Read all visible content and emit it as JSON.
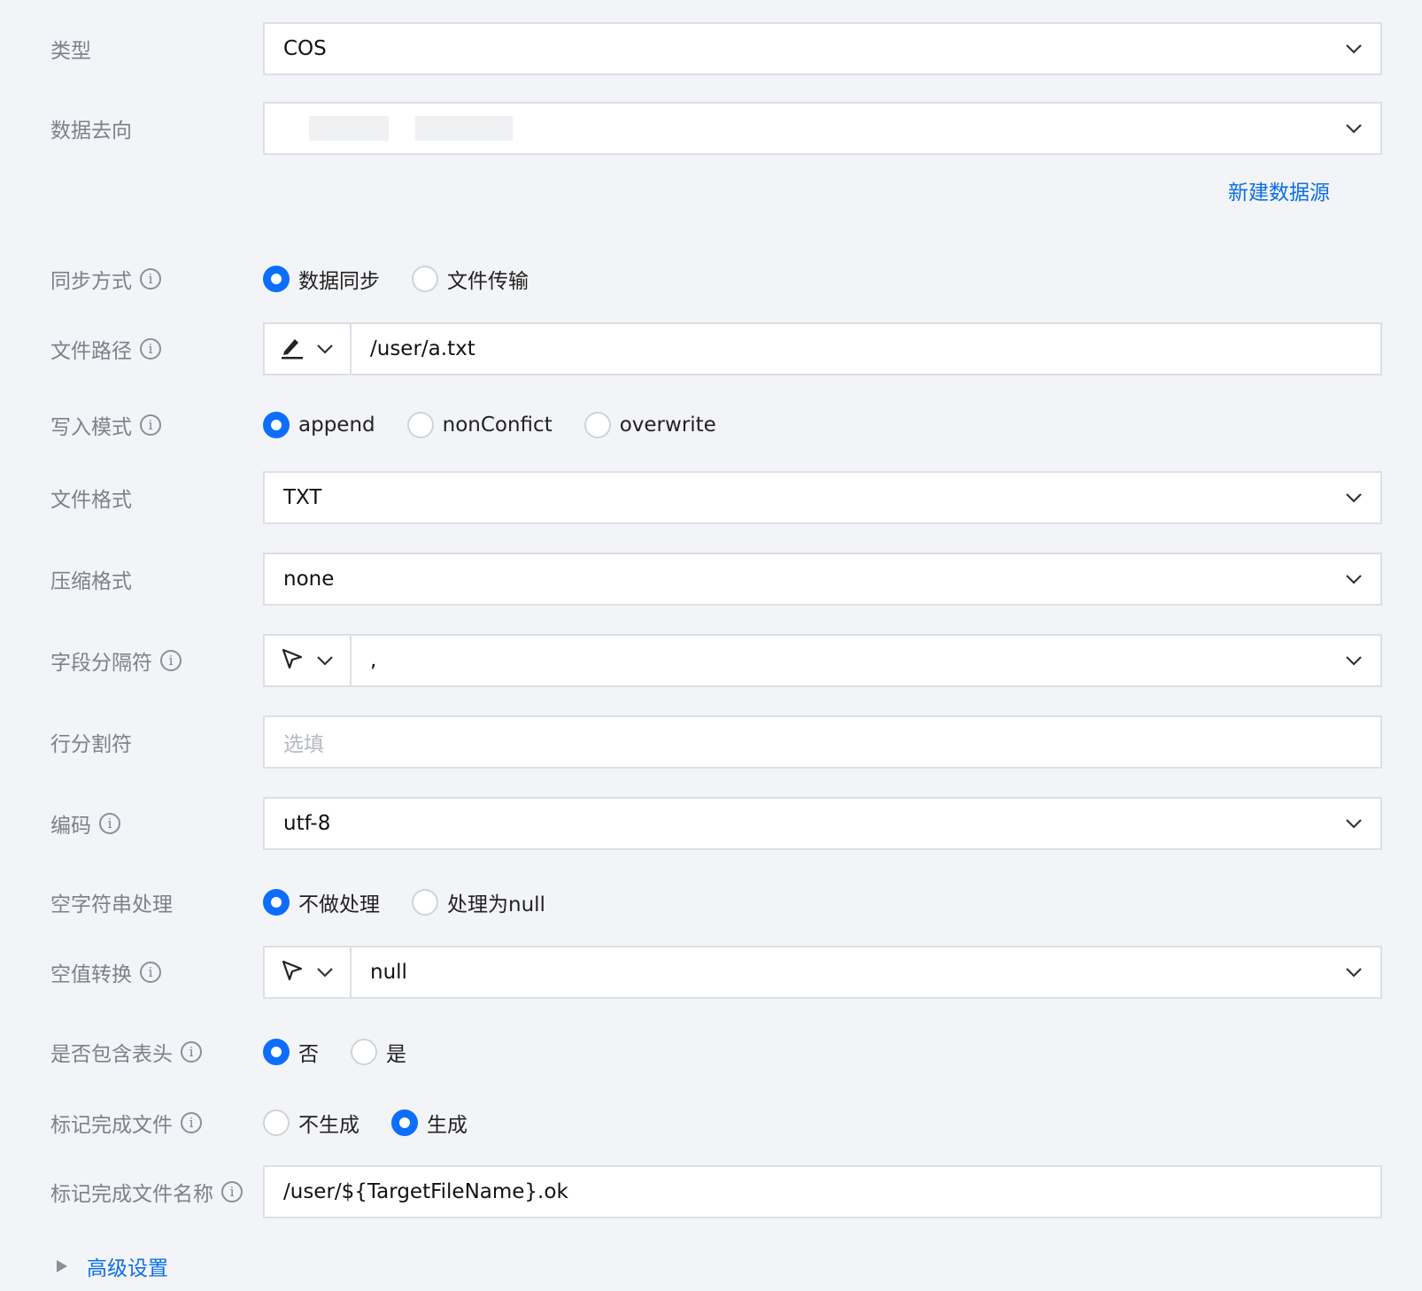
{
  "type": {
    "label": "类型",
    "value": "COS"
  },
  "destination": {
    "label": "数据去向",
    "value": "",
    "new_source_link": "新建数据源"
  },
  "sync_mode": {
    "label": "同步方式",
    "options": [
      "数据同步",
      "文件传输"
    ],
    "selected": 0
  },
  "file_path": {
    "label": "文件路径",
    "prefix_icon": "edit-pen-icon",
    "value": "/user/a.txt"
  },
  "write_mode": {
    "label": "写入模式",
    "options": [
      "append",
      "nonConfict",
      "overwrite"
    ],
    "selected": 0
  },
  "file_format": {
    "label": "文件格式",
    "value": "TXT"
  },
  "compression": {
    "label": "压缩格式",
    "value": "none"
  },
  "field_delimiter": {
    "label": "字段分隔符",
    "prefix_icon": "cursor-pointer-icon",
    "value": ","
  },
  "row_delimiter": {
    "label": "行分割符",
    "placeholder": "选填"
  },
  "encoding": {
    "label": "编码",
    "value": "utf-8"
  },
  "empty_string": {
    "label": "空字符串处理",
    "options": [
      "不做处理",
      "处理为null"
    ],
    "selected": 0
  },
  "null_conversion": {
    "label": "空值转换",
    "prefix_icon": "cursor-pointer-icon",
    "value": "null"
  },
  "include_header": {
    "label": "是否包含表头",
    "options": [
      "否",
      "是"
    ],
    "selected": 0
  },
  "mark_done_file": {
    "label": "标记完成文件",
    "options": [
      "不生成",
      "生成"
    ],
    "selected": 1
  },
  "mark_done_filename": {
    "label": "标记完成文件名称",
    "value": "/user/${TargetFileName}.ok"
  },
  "advanced": {
    "label": "高级设置"
  },
  "colors": {
    "accent": "#0d6efd",
    "link": "#0a6fe6",
    "label": "#7c818a",
    "border": "#dcdfe4"
  }
}
